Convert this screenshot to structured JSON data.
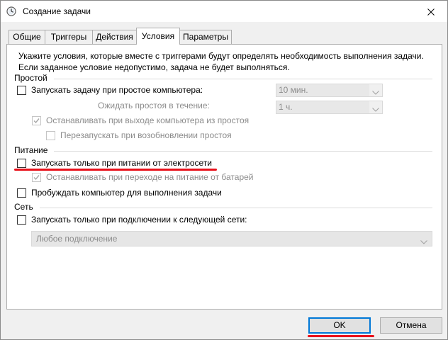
{
  "window": {
    "title": "Создание задачи",
    "icon": "clock-icon",
    "close_icon": "close-icon"
  },
  "tabs": [
    {
      "label": "Общие",
      "active": false
    },
    {
      "label": "Триггеры",
      "active": false
    },
    {
      "label": "Действия",
      "active": false
    },
    {
      "label": "Условия",
      "active": true
    },
    {
      "label": "Параметры",
      "active": false
    }
  ],
  "conditions": {
    "intro_line1": "Укажите условия, которые вместе с триггерами будут определять необходимость выполнения задачи.",
    "intro_line2": "Если заданное условие недопустимо, задача не будет выполняться.",
    "idle": {
      "heading": "Простой",
      "start_on_idle": {
        "label": "Запускать задачу при простое компьютера:",
        "checked": false
      },
      "idle_duration": {
        "value": "10 мин."
      },
      "wait_label": "Ожидать простоя в течение:",
      "wait_timeout": {
        "value": "1 ч."
      },
      "stop_on_resume": {
        "label": "Останавливать при выходе компьютера из простоя",
        "checked": true,
        "enabled": false
      },
      "restart_on_idle": {
        "label": "Перезапускать при возобновлении простоя",
        "checked": false,
        "enabled": false
      }
    },
    "power": {
      "heading": "Питание",
      "ac_only": {
        "label": "Запускать только при питании от электросети",
        "checked": false
      },
      "stop_on_battery": {
        "label": "Останавливать при переходе на питание от батарей",
        "checked": true,
        "enabled": false
      },
      "wake_to_run": {
        "label": "Пробуждать компьютер для выполнения задачи",
        "checked": false
      }
    },
    "network": {
      "heading": "Сеть",
      "network_only": {
        "label": "Запускать только при подключении к следующей сети:",
        "checked": false
      },
      "connection": {
        "value": "Любое подключение"
      }
    }
  },
  "buttons": {
    "ok": "OK",
    "cancel": "Отмена"
  },
  "colors": {
    "accent": "#0078d7",
    "annotation": "#e8101a",
    "disabled_text": "#8c8c8c"
  }
}
